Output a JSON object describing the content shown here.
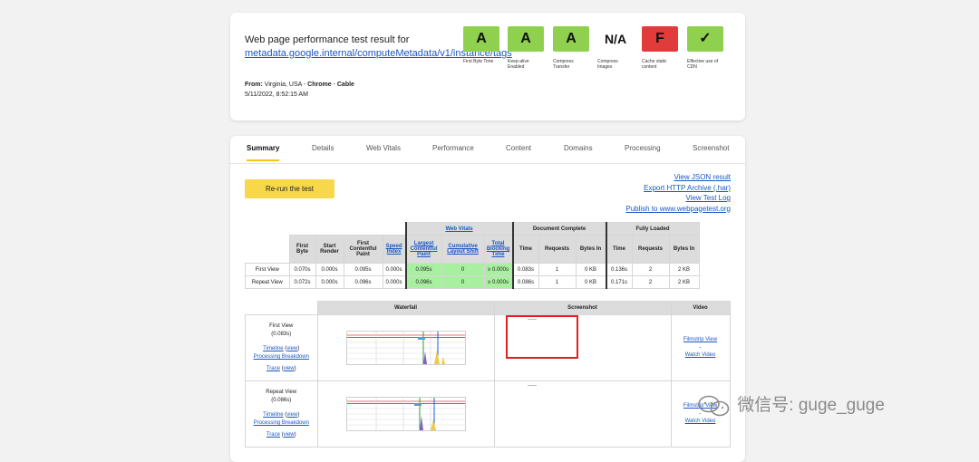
{
  "header": {
    "title_prefix": "Web page performance test result for",
    "url": "metadata.google.internal/computeMetadata/v1/instance/tags",
    "from_label": "From:",
    "location": "Virginia, USA",
    "sep": "-",
    "browser": "Chrome",
    "connection": "Cable",
    "datetime": "5/11/2022, 8:52:15 AM"
  },
  "grades": [
    {
      "grade": "A",
      "label": "First Byte Time",
      "color": "#8fd14f"
    },
    {
      "grade": "A",
      "label": "Keep-alive Enabled",
      "color": "#8fd14f"
    },
    {
      "grade": "A",
      "label": "Compress Transfer",
      "color": "#8fd14f"
    },
    {
      "grade": "N/A",
      "label": "Compress Images",
      "color": "#ffffff"
    },
    {
      "grade": "F",
      "label": "Cache static content",
      "color": "#e23b3b"
    },
    {
      "grade": "✓",
      "label": "Effective use of CDN",
      "color": "#8fd14f"
    }
  ],
  "tabs": [
    "Summary",
    "Details",
    "Web Vitals",
    "Performance",
    "Content",
    "Domains",
    "Processing",
    "Screenshot"
  ],
  "rerun_label": "Re-run the test",
  "links": [
    "View JSON result",
    "Export HTTP Archive (.har)",
    "View Test Log",
    "Publish to www.webpagetest.org"
  ],
  "results": {
    "group_web_vitals": "Web Vitals",
    "group_doc": "Document Complete",
    "group_full": "Fully Loaded",
    "headers": [
      "First Byte",
      "Start Render",
      "First Contentful Paint",
      "Speed Index",
      "Largest Contentful Paint",
      "Cumulative Layout Shift",
      "Total Blocking Time",
      "Time",
      "Requests",
      "Bytes In",
      "Time",
      "Requests",
      "Bytes In"
    ],
    "rows": [
      {
        "label": "First View",
        "cells": [
          "0.070s",
          "0.000s",
          "0.095s",
          "0.000s",
          "0.095s",
          "0",
          "≥ 0.000s",
          "0.083s",
          "1",
          "0 KB",
          "0.136s",
          "2",
          "2 KB"
        ]
      },
      {
        "label": "Repeat View",
        "cells": [
          "0.072s",
          "0.000s",
          "0.096s",
          "0.000s",
          "0.096s",
          "0",
          "≥ 0.000s",
          "0.086s",
          "1",
          "0 KB",
          "0.171s",
          "2",
          "2 KB"
        ]
      }
    ]
  },
  "details": {
    "headers": [
      "Waterfall",
      "Screenshot",
      "Video"
    ],
    "rows": [
      {
        "view": "First View",
        "time": "(0.083s)",
        "timeline": "Timeline",
        "view_link": "view",
        "processing": "Processing Breakdown",
        "trace": "Trace",
        "filmstrip": "Filmstrip View",
        "dash": "-",
        "watch": "Watch Video"
      },
      {
        "view": "Repeat View",
        "time": "(0.086s)",
        "timeline": "Timeline",
        "view_link": "view",
        "processing": "Processing Breakdown",
        "trace": "Trace",
        "filmstrip": "Filmstrip View",
        "dash": "-",
        "watch": "Watch Video"
      }
    ]
  },
  "watermark": "微信号: guge_guge",
  "colors": {
    "accent_yellow": "#f7d84b",
    "web_vitals_green": "#a8f0a0",
    "link_blue": "#1a56c4",
    "highlight_red": "#e02020"
  }
}
